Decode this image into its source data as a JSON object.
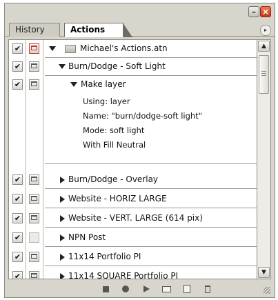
{
  "window": {
    "minimize_glyph": "–",
    "close_glyph": "×"
  },
  "tabs": [
    {
      "label": "History",
      "active": false
    },
    {
      "label": "Actions",
      "active": true
    }
  ],
  "panel_menu_glyph": "▸",
  "actions": {
    "set_name": "Michael's Actions.atn",
    "items": [
      {
        "label": "Burn/Dodge - Soft Light",
        "expanded": true
      },
      {
        "label": "Make layer",
        "expanded": true
      },
      {
        "label": "Burn/Dodge - Overlay",
        "expanded": false
      },
      {
        "label": "Website - HORIZ LARGE",
        "expanded": false
      },
      {
        "label": "Website - VERT. LARGE (614 pix)",
        "expanded": false
      },
      {
        "label": "NPN Post",
        "expanded": false
      },
      {
        "label": "11x14 Portfolio PI",
        "expanded": false
      },
      {
        "label": "11x14 SQUARE Portfolio PI",
        "expanded": false
      }
    ],
    "make_layer_details": {
      "using": "Using: layer",
      "name": "Name:  \"burn/dodge-soft light\"",
      "mode": "Mode: soft light",
      "fill": "With Fill Neutral"
    }
  },
  "check_glyph": "✔",
  "scrollbar": {
    "up_glyph": "▲",
    "down_glyph": "▼",
    "position_fraction": 0.0
  },
  "colors": {
    "dialog_toggle_red": "#c0392b",
    "panel_bg": "#d8d5cc"
  },
  "toolbar_icons": [
    "stop-icon",
    "record-icon",
    "play-icon",
    "new-set-icon",
    "new-action-icon",
    "delete-icon"
  ]
}
